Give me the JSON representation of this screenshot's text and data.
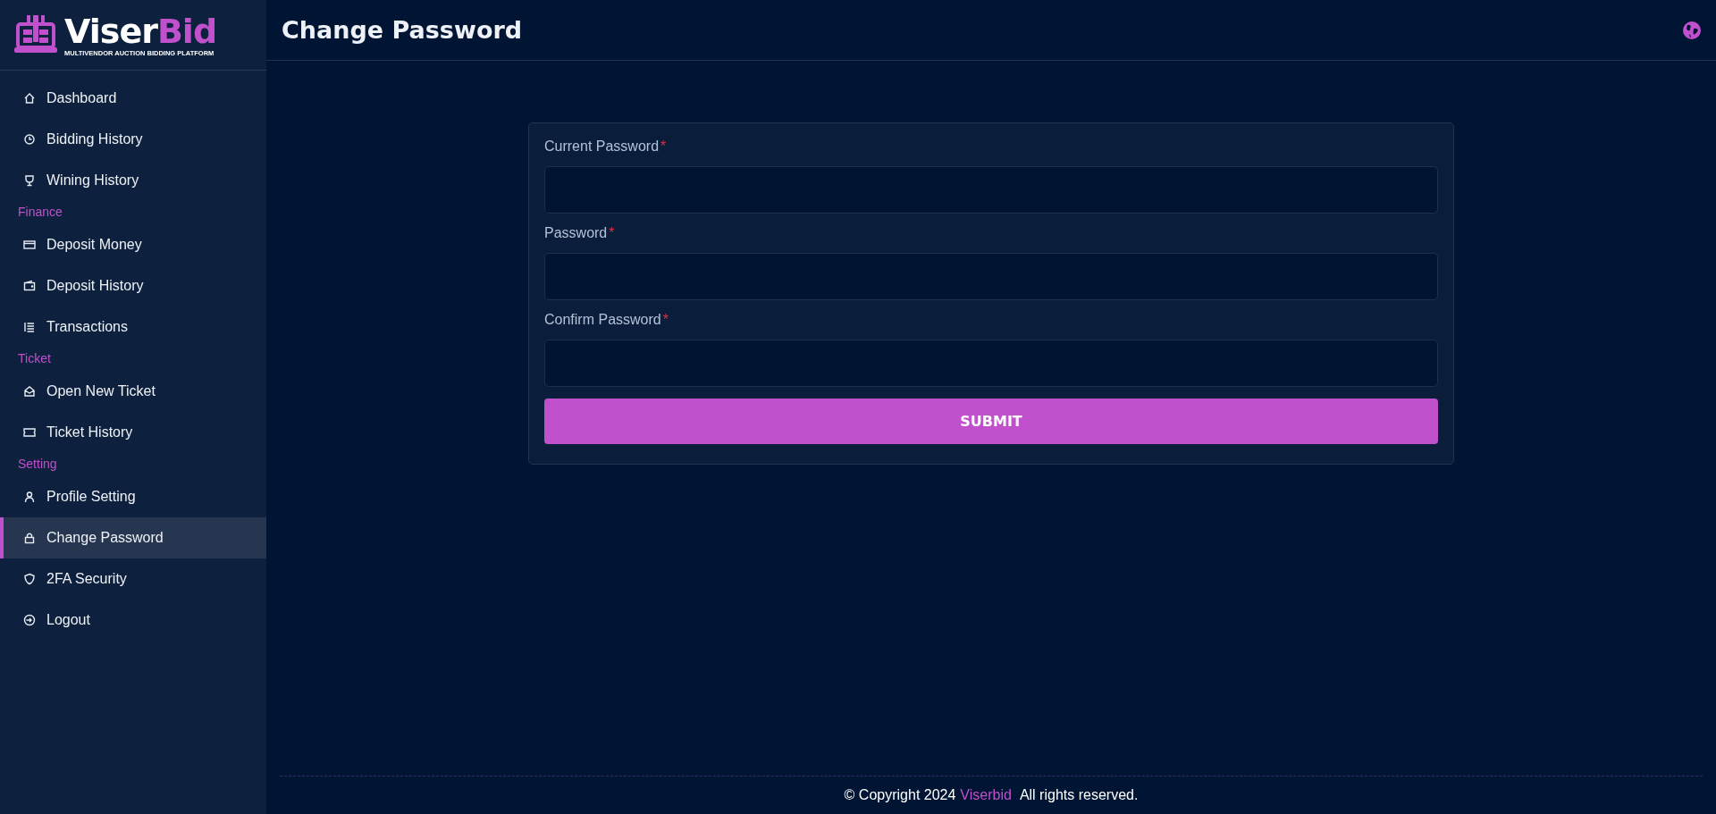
{
  "logo": {
    "name_part_1": "Viser",
    "name_part_2": "Bid",
    "tagline": "MULTIVENDOR AUCTION BIDDING PLATFORM"
  },
  "sidebar": {
    "items": [
      {
        "kind": "link",
        "label": "Dashboard",
        "selected": false
      },
      {
        "kind": "link",
        "label": "Bidding History",
        "selected": false
      },
      {
        "kind": "link",
        "label": "Wining History",
        "selected": false
      },
      {
        "kind": "section",
        "label": "Finance"
      },
      {
        "kind": "link",
        "label": "Deposit Money",
        "selected": false
      },
      {
        "kind": "link",
        "label": "Deposit History",
        "selected": false
      },
      {
        "kind": "link",
        "label": "Transactions",
        "selected": false
      },
      {
        "kind": "section",
        "label": "Ticket"
      },
      {
        "kind": "link",
        "label": "Open New Ticket",
        "selected": false
      },
      {
        "kind": "link",
        "label": "Ticket History",
        "selected": false
      },
      {
        "kind": "section",
        "label": "Setting"
      },
      {
        "kind": "link",
        "label": "Profile Setting",
        "selected": false
      },
      {
        "kind": "link",
        "label": "Change Password",
        "selected": true
      },
      {
        "kind": "link",
        "label": "2FA Security",
        "selected": false
      },
      {
        "kind": "link",
        "label": "Logout",
        "selected": false
      }
    ]
  },
  "header": {
    "title": "Change Password"
  },
  "form": {
    "fields": [
      {
        "label": "Current Password",
        "required_mark": "*"
      },
      {
        "label": "Password",
        "required_mark": "*"
      },
      {
        "label": "Confirm Password",
        "required_mark": "*"
      }
    ],
    "submit": "SUBMIT"
  },
  "footer": {
    "prefix": "© Copyright 2024",
    "link": "Viserbid",
    "suffix": "All rights reserved."
  }
}
